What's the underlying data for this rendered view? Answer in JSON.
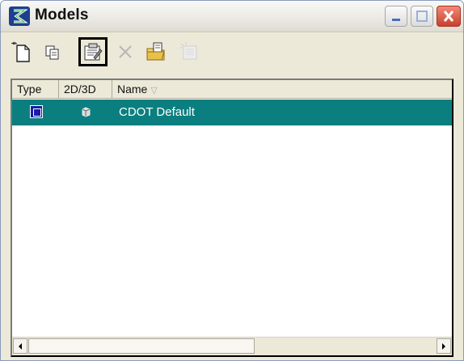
{
  "window": {
    "title": "Models"
  },
  "titlebar_buttons": [
    "minimize-icon",
    "maximize-icon",
    "close-icon"
  ],
  "toolbar": {
    "tools": [
      {
        "name": "new-model-icon"
      },
      {
        "name": "copy-model-icon"
      },
      {
        "name": "edit-properties-icon",
        "active": true
      },
      {
        "name": "delete-model-icon",
        "disabled": true
      },
      {
        "name": "import-icon"
      },
      {
        "name": "active-model-icon",
        "disabled": true
      }
    ]
  },
  "list": {
    "columns": {
      "type": "Type",
      "dim": "2D/3D",
      "name": "Name"
    },
    "rows": [
      {
        "type_icon": "model-design-icon",
        "dim_icon": "3d-model-icon",
        "name": "CDOT Default",
        "selected": true
      }
    ]
  },
  "colors": {
    "selection": "#0b7f7f",
    "close_button": "#c9402b"
  }
}
